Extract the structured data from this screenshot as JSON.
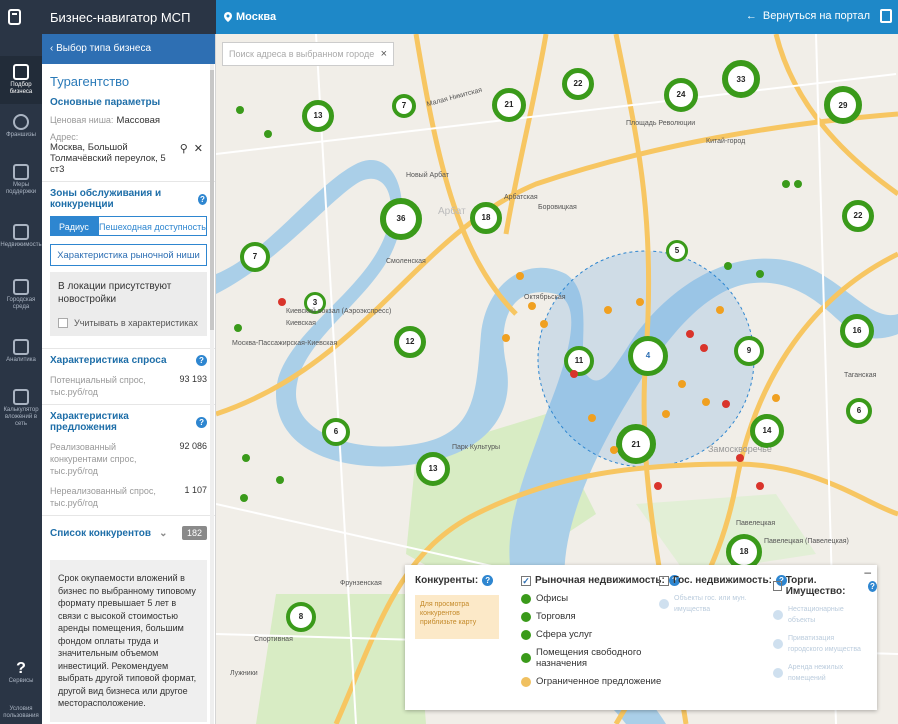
{
  "header": {
    "app_title": "Бизнес-навигатор МСП",
    "city": "Москва",
    "back_to_portal": "Вернуться на портал"
  },
  "rail": {
    "items": [
      {
        "label": "Подбор бизнеса",
        "active": true
      },
      {
        "label": "Франшизы",
        "active": false
      },
      {
        "label": "Меры поддержки",
        "active": false
      },
      {
        "label": "Недвижимость",
        "active": false
      },
      {
        "label": "Городская среда",
        "active": false
      },
      {
        "label": "Аналитика",
        "active": false
      },
      {
        "label": "Калькулятор вложений в сеть",
        "active": false
      }
    ],
    "help_label": "Сервисы",
    "bottom_label": "Условия пользования"
  },
  "panel": {
    "back_label": "‹ Выбор типа бизнеса",
    "business_type": "Турагентство",
    "main_params_title": "Основные параметры",
    "price_niche_label": "Ценовая ниша:",
    "price_niche_value": "Массовая",
    "address_label": "Адрес:",
    "address_value": "Москва, Большой Толмачёвский переулок, 5 ст3",
    "zones_title": "Зоны обслуживания и конкуренции",
    "tab_radius": "Радиус",
    "tab_walk": "Пешеходная доступность",
    "market_button": "Характеристика рыночной ниши",
    "new_buildings_text": "В локации присутствуют новостройки",
    "new_buildings_checkbox": "Учитывать в характеристиках",
    "demand_title": "Характеристика спроса",
    "demand_label": "Потенциальный спрос, тыс.руб/год",
    "demand_value": "93 193",
    "supply_title": "Характеристика предложения",
    "supply_realized_label": "Реализованный конкурентами спрос, тыс.руб/год",
    "supply_realized_value": "92 086",
    "supply_unrealized_label": "Нереализованный спрос, тыс.руб/год",
    "supply_unrealized_value": "1 107",
    "competitors_label": "Список конкурентов",
    "competitors_count": "182",
    "warning_text": "Срок окупаемости вложений в бизнес по выбранному типовому формату превышает 5 лет в связи с высокой стоимостью аренды помещения, большим фондом оплаты труда и значительным объемом инвестиций. Рекомендуем выбрать другой типовой формат, другой вид бизнеса или другое месторасположение."
  },
  "map": {
    "search_placeholder": "Поиск адреса в выбранном городе",
    "clusters": [
      "13",
      "7",
      "21",
      "22",
      "24",
      "33",
      "29",
      "36",
      "18",
      "22",
      "7",
      "5",
      "3",
      "12",
      "11",
      "9",
      "16",
      "6",
      "14",
      "21",
      "6",
      "13",
      "18",
      "8"
    ],
    "center_marker": "4",
    "labels": [
      "Малая Никитская",
      "Новый Арбат",
      "Арбатская",
      "Боровицкая",
      "Смоленская",
      "Киевская",
      "Парк Культуры",
      "Октябрьская",
      "Павелецкая",
      "Таганская",
      "Фрунзенская",
      "Спортивная",
      "Лужники",
      "Китай-город",
      "Площадь Революции",
      "Арбат",
      "Замоскворечье",
      "Москва-Пассажирская-Киевская",
      "Киевский вокзал (Аэроэкспресс)",
      "Павелецкая (Павелецкая)"
    ]
  },
  "legend": {
    "competitors_title": "Конкуренты:",
    "competitors_note": "Для просмотра конкурентов приблизьте карту",
    "market_title": "Рыночная недвижимость:",
    "market_items": [
      "Офисы",
      "Торговля",
      "Сфера услуг",
      "Помещения свободного назначения",
      "Ограниченное предложение"
    ],
    "gov_title": "Гос. недвижимость:",
    "gov_items": [
      "Объекты гос. или мун. имущества"
    ],
    "auction_title": "Торги. Имущество:",
    "auction_items": [
      "Нестационарные объекты",
      "Приватизация городского имущества",
      "Аренда нежилых помещений"
    ],
    "collapse": "–"
  },
  "colors": {
    "rail_bg": "#2a3545",
    "topbar_blue": "#1e88c8",
    "accent_blue": "#2e86d0",
    "cluster_green": "#3a9a1a",
    "pin_orange": "#f0a020",
    "pin_red": "#d9342b"
  }
}
